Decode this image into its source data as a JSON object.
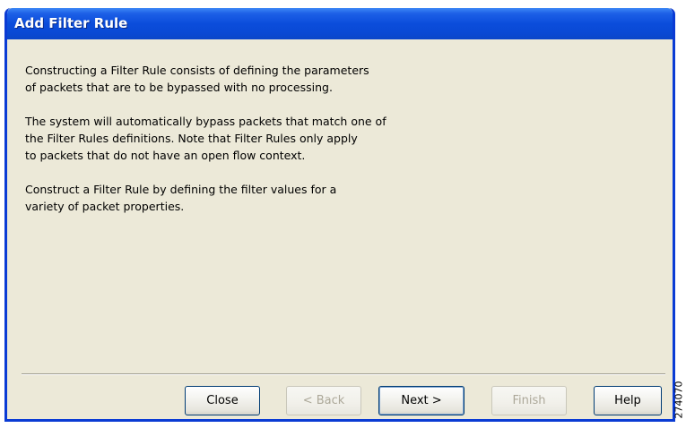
{
  "window": {
    "title": "Add Filter Rule"
  },
  "content": {
    "paragraphs": [
      "Constructing a Filter Rule consists of defining the parameters\nof packets that are to be bypassed with no processing.",
      "The system will automatically bypass packets that match one of\nthe Filter Rules definitions. Note that Filter Rules only apply\nto packets that do not have an open flow context.",
      "Construct a Filter Rule by defining the filter values for a\nvariety of packet properties."
    ]
  },
  "buttons": {
    "close": {
      "label": "Close",
      "enabled": true
    },
    "back": {
      "label": "< Back",
      "enabled": false
    },
    "next": {
      "label": "Next >",
      "enabled": true
    },
    "finish": {
      "label": "Finish",
      "enabled": false
    },
    "help": {
      "label": "Help",
      "enabled": true
    }
  },
  "figure_id": "274070"
}
